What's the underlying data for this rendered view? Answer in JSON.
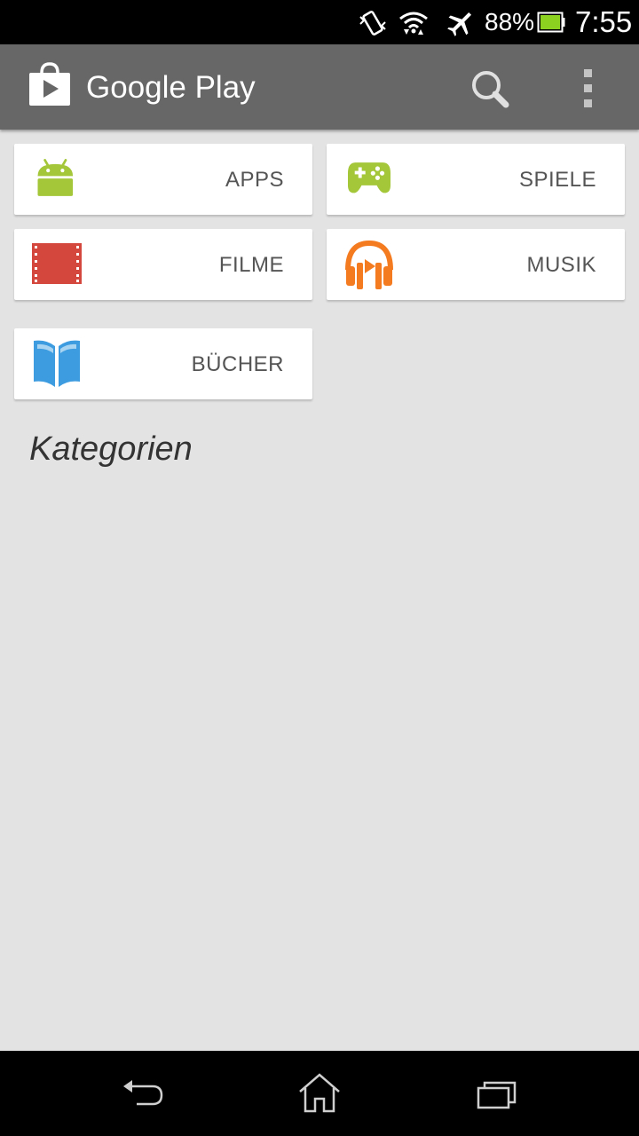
{
  "status_bar": {
    "icons": [
      "vibrate-icon",
      "wifi-icon",
      "airplane-mode-icon",
      "battery-icon"
    ],
    "battery_percent": "88%",
    "time": "7:55"
  },
  "action_bar": {
    "title": "Google Play",
    "icons": [
      "google-play-bag-icon",
      "search-icon",
      "overflow-menu-icon"
    ]
  },
  "categories": [
    {
      "label": "APPS",
      "icon": "android-robot-icon",
      "color": "#a4c639"
    },
    {
      "label": "SPIELE",
      "icon": "gamepad-icon",
      "color": "#a4c639"
    },
    {
      "label": "FILME",
      "icon": "film-strip-icon",
      "color": "#d4473d"
    },
    {
      "label": "MUSIK",
      "icon": "headphones-icon",
      "color": "#f47b20"
    },
    {
      "label": "BÜCHER",
      "icon": "book-icon",
      "color": "#3d9ce0"
    }
  ],
  "section_title": "Kategorien",
  "nav_bar": {
    "icons": [
      "back-icon",
      "home-icon",
      "recent-apps-icon"
    ]
  },
  "colors": {
    "action_bar": "#676767",
    "background": "#e3e3e3",
    "tile": "#ffffff"
  }
}
